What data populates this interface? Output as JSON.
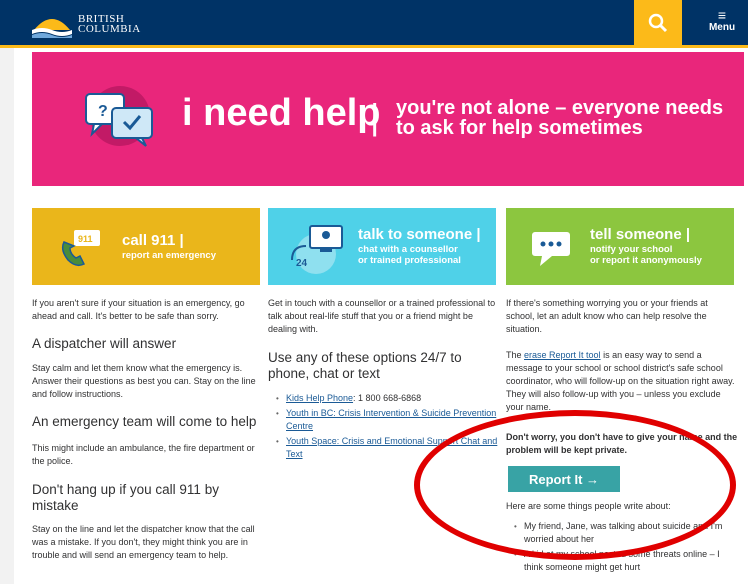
{
  "header": {
    "logo_line1": "BRITISH",
    "logo_line2": "COLUMBIA",
    "search_icon": "search-icon",
    "menu_label": "Menu"
  },
  "hero": {
    "title": "i need help",
    "divider": "|",
    "subtitle_line1": "you're not alone – everyone needs",
    "subtitle_line2": "to ask for help sometimes",
    "icon": "chat-bubbles-icon",
    "color": "#e9267b"
  },
  "cards": [
    {
      "title": "call 911 |",
      "sub": "report an emergency",
      "icon": "phone-911-icon",
      "color": "#eab61b"
    },
    {
      "title": "talk to someone |",
      "sub_line1": "chat with a counsellor",
      "sub_line2": "or trained professional",
      "icon": "computer-24-icon",
      "color": "#4fd1e8"
    },
    {
      "title": "tell someone |",
      "sub_line1": "notify your school",
      "sub_line2": "or report it anonymously",
      "icon": "message-bubble-icon",
      "color": "#8cc63f"
    }
  ],
  "col1": {
    "intro": "If you aren't sure if your situation is an emergency, go ahead and call. It's better to be safe than sorry.",
    "h1": "A dispatcher will answer",
    "p1": "Stay calm and let them know what the emergency is. Answer their questions as best you can. Stay on the line and follow instructions.",
    "h2": "An emergency team will come to help",
    "p2": "This might include an ambulance, the fire department or the police.",
    "h3": "Don't hang up if you call 911 by mistake",
    "p3": "Stay on the line and let the dispatcher know that the call was a mistake. If you don't, they might think you are in trouble and will send an emergency team to help."
  },
  "col2": {
    "intro": "Get in touch with a counsellor or a trained professional to talk about real-life stuff that you or a friend might be dealing with.",
    "h1": "Use any of these options 24/7 to phone, chat or text",
    "link1": "Kids Help Phone",
    "link1_suffix": ": 1 800 668-6868",
    "link2": "Youth in BC: Crisis Intervention & Suicide Prevention Centre",
    "link3": "Youth Space: Crisis and Emotional Support Chat and Text"
  },
  "col3": {
    "intro": "If there's something worrying you or your friends at school, let an adult know who can help resolve the situation.",
    "p1_pre": "The ",
    "p1_link": "erase Report It tool",
    "p1_post": " is an easy way to send a message to your school or school district's safe school coordinator, who will follow-up on the situation right away. They will also follow-up with you – unless you exclude your name.",
    "bold": "Don't worry, you don't have to give your name and the problem will be kept private.",
    "button": "Report It →",
    "p2": "Here are some things people write about:",
    "item1": "My friend, Jane, was talking about suicide and I'm worried about her",
    "item2": "A kid at my school posted some threats online – I think someone might get hurt"
  }
}
